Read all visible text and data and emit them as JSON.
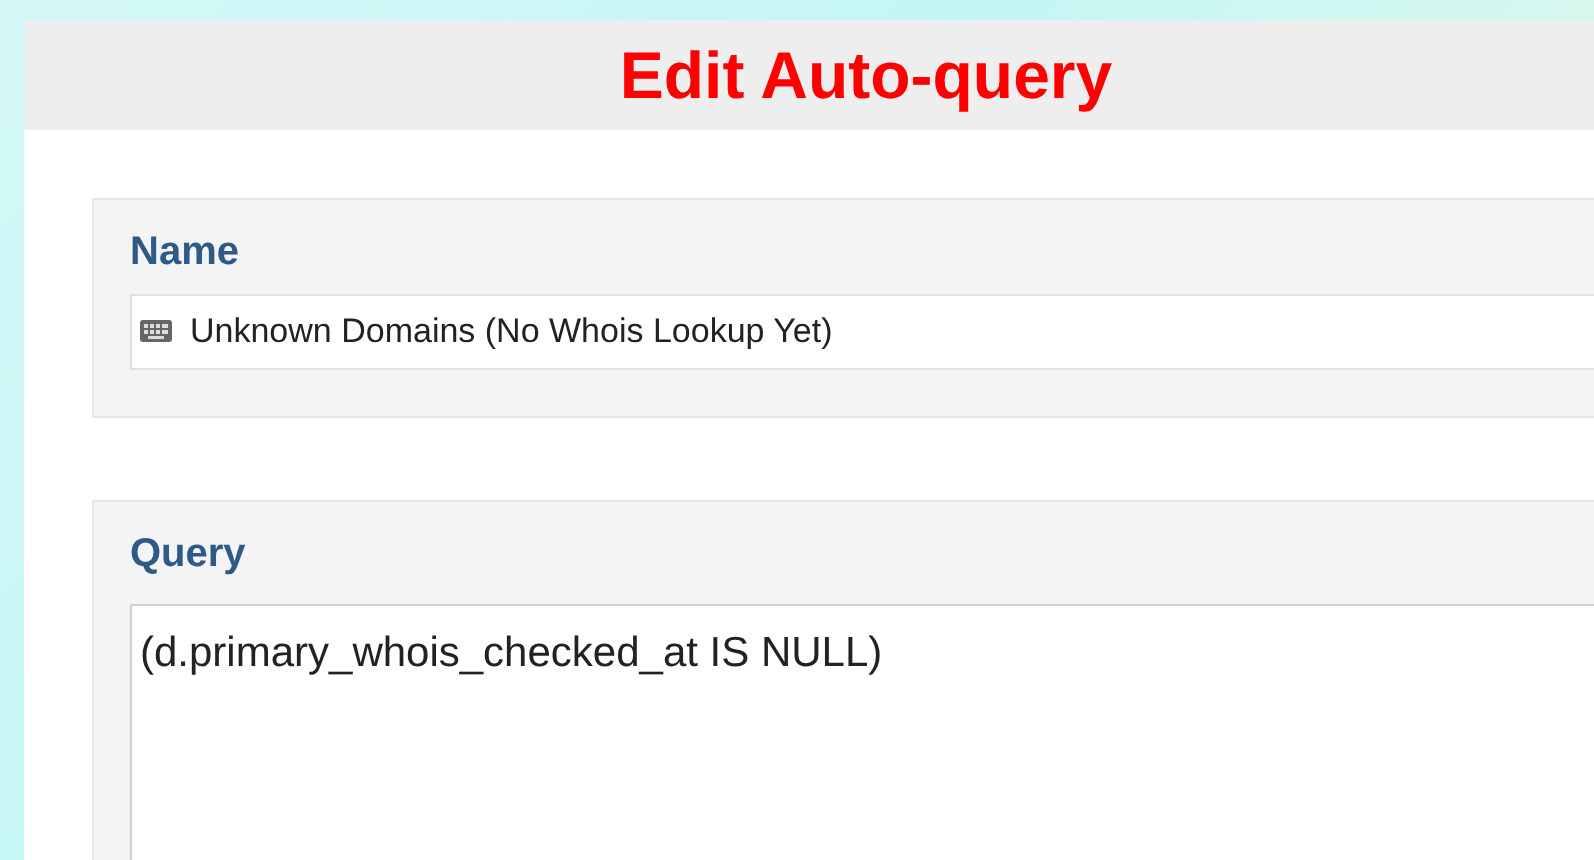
{
  "dialog": {
    "title": "Edit Auto-query"
  },
  "name_section": {
    "label": "Name",
    "value": "Unknown Domains (No Whois Lookup Yet)"
  },
  "query_section": {
    "label": "Query",
    "value": "(d.primary_whois_checked_at IS NULL)"
  }
}
